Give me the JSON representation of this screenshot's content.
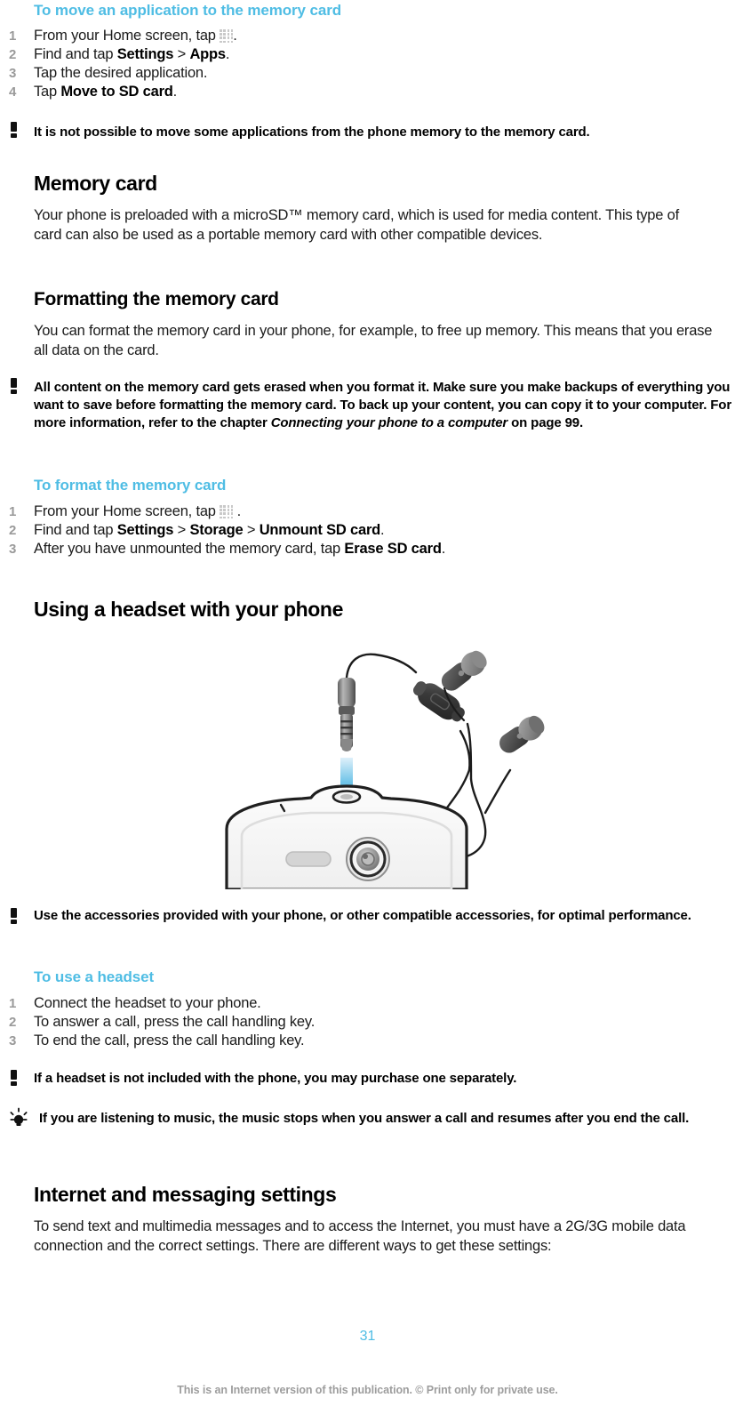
{
  "document": {
    "page_number": "31",
    "footer_text": "This is an Internet version of this publication. © Print only for private use.",
    "accent_color": "#4FBDE4",
    "body_color": "#1a1a1a",
    "list_number_color": "#9a9a9a"
  },
  "sections": {
    "move_app": {
      "heading": "To move an application to the memory card",
      "steps": [
        {
          "num": "1",
          "pre": "From your Home screen, tap ",
          "icon": "apps-grid-icon",
          "post": "."
        },
        {
          "num": "2",
          "pre": "Find and tap ",
          "bold1": "Settings",
          "sep": " > ",
          "bold2": "Apps",
          "post": "."
        },
        {
          "num": "3",
          "pre": "Tap the desired application.",
          "post": ""
        },
        {
          "num": "4",
          "pre": "Tap ",
          "bold1": "Move to SD card",
          "post": "."
        }
      ],
      "note": "It is not possible to move some applications from the phone memory to the memory card."
    },
    "memory_card": {
      "heading": "Memory card",
      "paragraph": "Your phone is preloaded with a microSD™ memory card, which is used for media content. This type of card can also be used as a portable memory card with other compatible devices."
    },
    "formatting": {
      "heading": "Formatting the memory card",
      "paragraph": "You can format the memory card in your phone, for example, to free up memory. This means that you erase all data on the card.",
      "note_part1": "All content on the memory card gets erased when you format it. Make sure you make backups of everything you want to save before formatting the memory card. To back up your content, you can copy it to your computer. For more information, refer to the chapter ",
      "note_italic": "Connecting your phone to a computer",
      "note_part2": " on page 99."
    },
    "format_card": {
      "heading": "To format the memory card",
      "steps": [
        {
          "num": "1",
          "pre": "From your Home screen, tap ",
          "icon": "apps-grid-icon",
          "post": " ."
        },
        {
          "num": "2",
          "pre": "Find and tap ",
          "bold1": "Settings",
          "sep1": " > ",
          "bold2": "Storage",
          "sep2": " > ",
          "bold3": "Unmount SD card",
          "post": "."
        },
        {
          "num": "3",
          "pre": "After you have unmounted the memory card, tap ",
          "bold1": "Erase SD card",
          "post": "."
        }
      ]
    },
    "headset": {
      "heading": "Using a headset with your phone",
      "illustration_alt": "headset-and-phone-illustration",
      "note": "Use the accessories provided with your phone, or other compatible accessories, for optimal performance.",
      "use_heading": "To use a headset",
      "steps": [
        {
          "num": "1",
          "text": "Connect the headset to your phone."
        },
        {
          "num": "2",
          "text": "To answer a call, press the call handling key."
        },
        {
          "num": "3",
          "text": "To end the call, press the call handling key."
        }
      ],
      "note2": "If a headset is not included with the phone, you may purchase one separately.",
      "tip": "If you are listening to music, the music stops when you answer a call and resumes after you end the call."
    },
    "internet": {
      "heading": "Internet and messaging settings",
      "paragraph": "To send text and multimedia messages and to access the Internet, you must have a 2G/3G mobile data connection and the correct settings. There are different ways to get these settings:"
    }
  }
}
